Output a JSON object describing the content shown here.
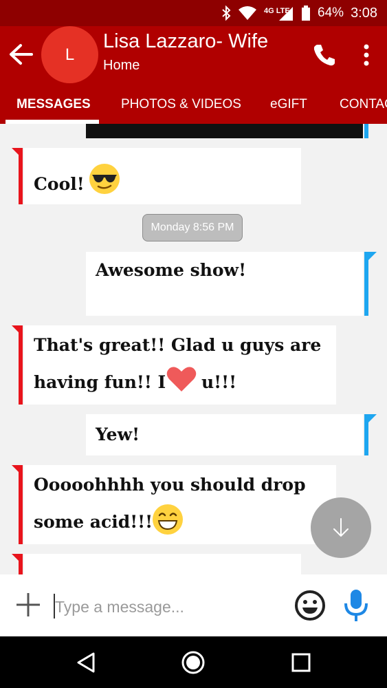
{
  "status_bar": {
    "network": "4G LTE",
    "battery": "64%",
    "time": "3:08"
  },
  "header": {
    "avatar_initial": "L",
    "contact_name": "Lisa Lazzaro- Wife",
    "contact_subtitle": "Home"
  },
  "tabs": [
    {
      "label": "MESSAGES",
      "active": true
    },
    {
      "label": "PHOTOS & VIDEOS",
      "active": false
    },
    {
      "label": "eGIFT",
      "active": false
    },
    {
      "label": "CONTACT",
      "active": false
    }
  ],
  "messages": [
    {
      "direction": "incoming",
      "text": "Cool!",
      "emoji": "sunglasses-emoji"
    },
    {
      "type": "timestamp",
      "text": "Monday 8:56 PM"
    },
    {
      "direction": "outgoing",
      "text": "Awesome show!"
    },
    {
      "direction": "incoming",
      "line1": "That's great!! Glad u guys are",
      "line2a": "having fun!! I",
      "line2b": "u!!!",
      "emoji": "heart-emoji"
    },
    {
      "direction": "outgoing",
      "text": "Yew!"
    },
    {
      "direction": "incoming",
      "line1": "Ooooohhhh you should drop",
      "line2": "some acid!!!!",
      "emoji": "grinning-emoji"
    }
  ],
  "composer": {
    "placeholder": "Type a message..."
  },
  "colors": {
    "status_bar": "#8e0000",
    "app_bar": "#b00000",
    "avatar": "#e53125",
    "incoming_accent": "#e8141c",
    "outgoing_accent": "#1ea6f0",
    "mic": "#1e88e5"
  }
}
